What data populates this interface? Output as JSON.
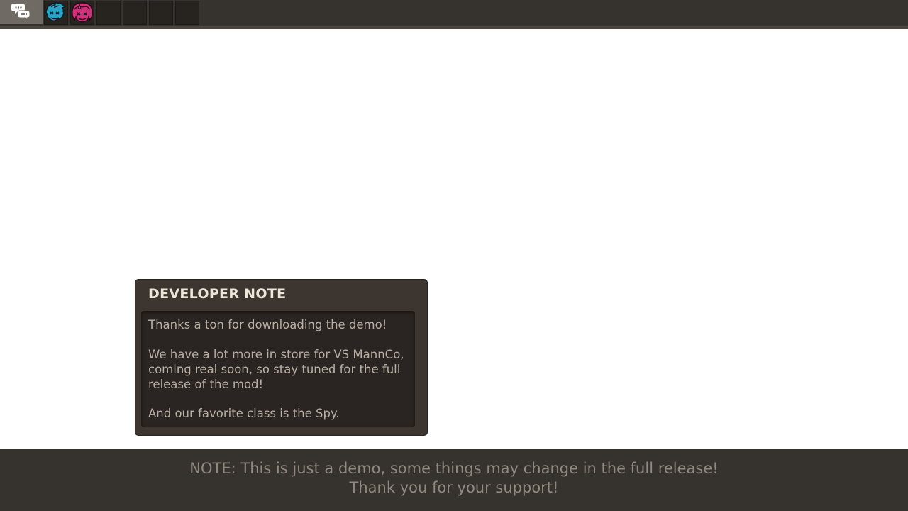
{
  "topbar": {
    "chat_icon": "chat-bubbles-icon",
    "slots": [
      {
        "icon": "boyfriend-character-icon",
        "color": "#2ba6c9",
        "filled": true
      },
      {
        "icon": "girlfriend-character-icon",
        "color": "#d1307a",
        "filled": true
      },
      {
        "icon": "empty-slot",
        "filled": false
      },
      {
        "icon": "empty-slot",
        "filled": false
      },
      {
        "icon": "empty-slot",
        "filled": false
      },
      {
        "icon": "empty-slot",
        "filled": false
      }
    ]
  },
  "developer_note": {
    "title": "DEVELOPER NOTE",
    "lines": [
      "Thanks a ton for downloading the demo!",
      "We have a lot more in store for VS MannCo,",
      "coming real soon, so stay tuned for the full",
      "release of the mod!",
      "And our favorite class is the Spy."
    ]
  },
  "footer": {
    "line1": "NOTE: This is just a demo, some things may change in the full release!",
    "line2": "Thank you for your support!"
  },
  "colors": {
    "bar_background": "#36322e",
    "panel_background": "#3c3530",
    "panel_inner": "#2a2522",
    "title_text": "#ece5d8",
    "body_text": "#b8b0a4",
    "footer_text": "#8f8982"
  }
}
